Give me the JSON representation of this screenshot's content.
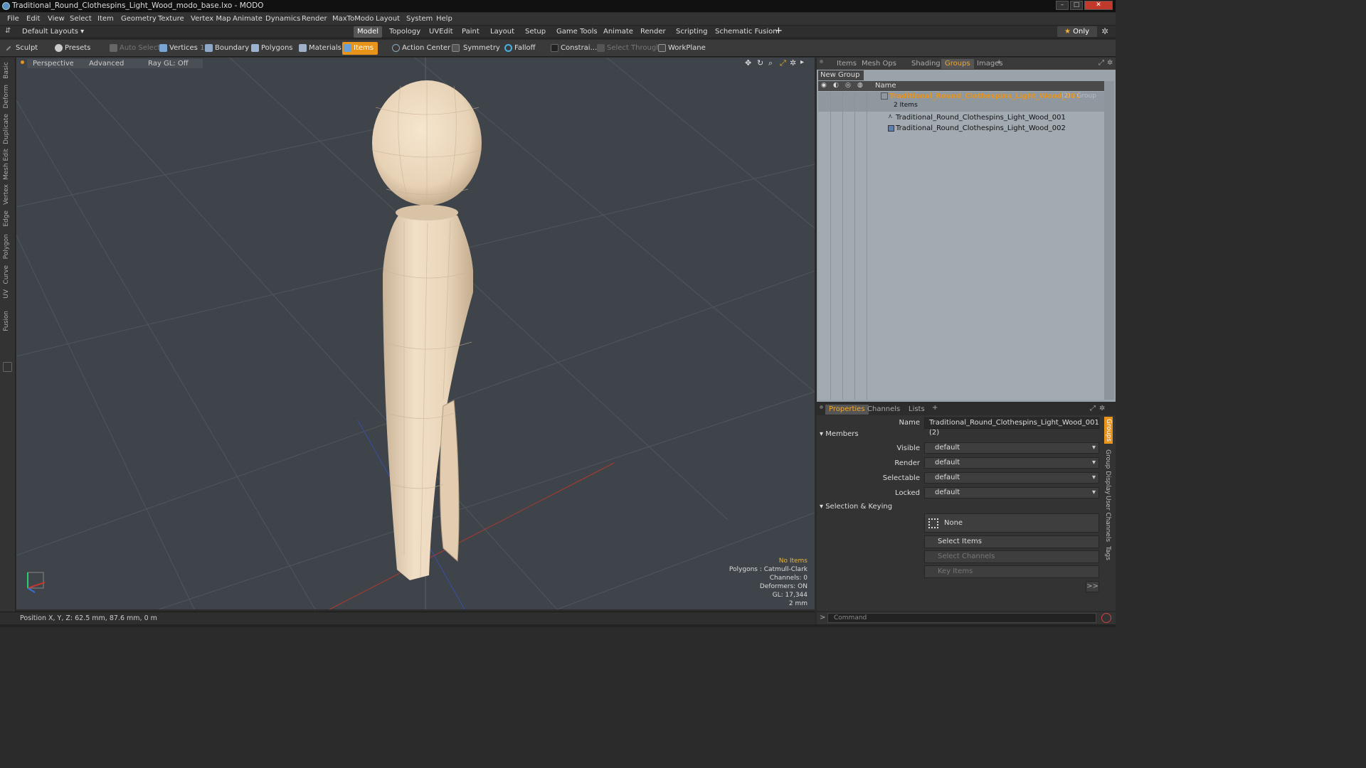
{
  "window": {
    "title": "Traditional_Round_Clothespins_Light_Wood_modo_base.lxo - MODO"
  },
  "menu": [
    "File",
    "Edit",
    "View",
    "Select",
    "Item",
    "Geometry",
    "Texture",
    "Vertex Map",
    "Animate",
    "Dynamics",
    "Render",
    "MaxToModo",
    "Layout",
    "System",
    "Help"
  ],
  "layouts_label": "Default Layouts",
  "mode_tabs": [
    "Model",
    "Topology",
    "UVEdit",
    "Paint",
    "Layout",
    "Setup",
    "Game Tools",
    "Animate",
    "Render",
    "Scripting",
    "Schematic Fusion"
  ],
  "only_label": "Only",
  "toolbar": {
    "sculpt": "Sculpt",
    "presets": "Presets",
    "auto_select": "Auto Select",
    "vertices": "Vertices",
    "vertices_count": "1",
    "boundary": "Boundary",
    "polygons": "Polygons",
    "materials": "Materials",
    "items": "Items",
    "action_center": "Action Center",
    "symmetry": "Symmetry",
    "falloff": "Falloff",
    "constraints": "Constrai...",
    "select_through": "Select Through",
    "workplane": "WorkPlane"
  },
  "left_tabs": [
    "Basic",
    "Deform",
    "Duplicate",
    "Mesh Edit",
    "Vertex",
    "Edge",
    "Polygon",
    "Curve",
    "UV",
    "Fusion"
  ],
  "viewport": {
    "perspective": "Perspective",
    "advanced": "Advanced",
    "raygl": "Ray GL: Off",
    "info": {
      "no_items": "No Items",
      "polygons": "Polygons : Catmull-Clark",
      "channels": "Channels: 0",
      "deformers": "Deformers: ON",
      "gl": "GL: 17,344",
      "scale": "2 mm"
    }
  },
  "status": {
    "position": "Position X, Y, Z:  62.5 mm, 87.6 mm, 0 m"
  },
  "groups_panel": {
    "tabs": [
      "Items",
      "Mesh Ops",
      "Shading",
      "Groups",
      "Images"
    ],
    "active_tab": "Groups",
    "new_group": "New Group",
    "name_header": "Name",
    "group_name": "Traditional_Round_Clothespins_Light_Wood_001",
    "group_suffix": "(2) : Group",
    "group_count": "2 Items",
    "children": [
      "Traditional_Round_Clothespins_Light_Wood_001",
      "Traditional_Round_Clothespins_Light_Wood_002"
    ]
  },
  "properties": {
    "tabs": [
      "Properties",
      "Channels",
      "Lists"
    ],
    "name_label": "Name",
    "name_value": "Traditional_Round_Clothespins_Light_Wood_001 (2)",
    "members": "Members",
    "visible_label": "Visible",
    "render_label": "Render",
    "selectable_label": "Selectable",
    "locked_label": "Locked",
    "default_value": "default",
    "sel_keying": "Selection & Keying",
    "none": "None",
    "select_items": "Select Items",
    "select_channels": "Select Channels",
    "key_items": "Key Items",
    "more": ">>",
    "side_tabs": [
      "Groups",
      "Group Display",
      "User Channels",
      "Tags"
    ]
  },
  "command": {
    "placeholder": "Command"
  },
  "colors": {
    "accent": "#e8941b",
    "viewport_bg": "#3e444a",
    "wood": "#ecd8bd"
  }
}
